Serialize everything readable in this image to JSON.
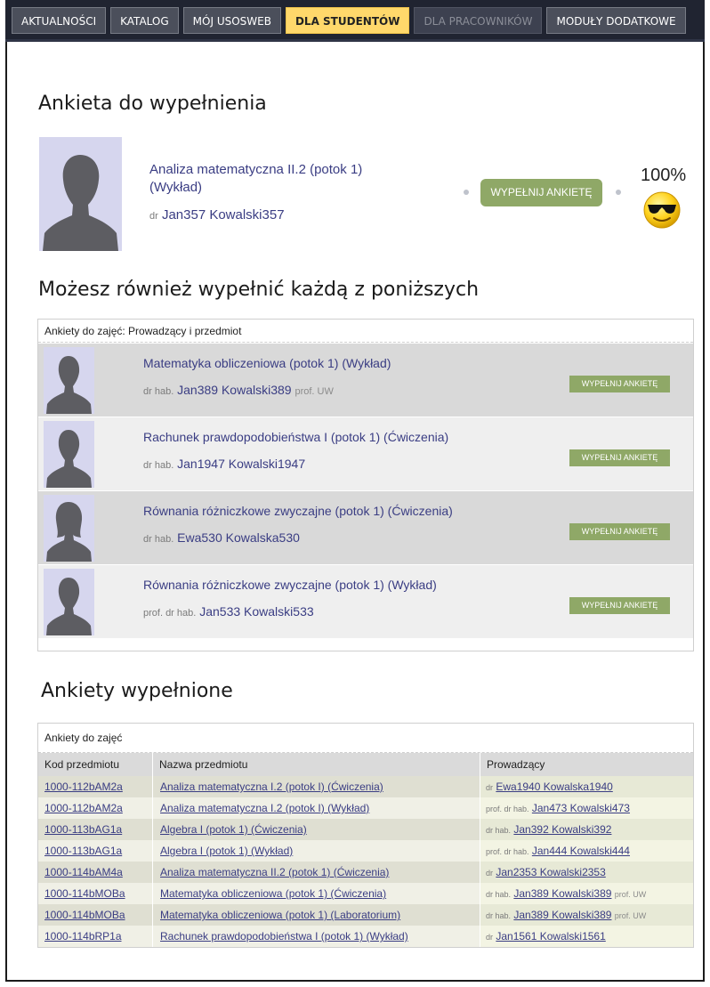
{
  "nav": {
    "tabs": [
      {
        "label": "AKTUALNOŚCI",
        "state": "normal"
      },
      {
        "label": "KATALOG",
        "state": "normal"
      },
      {
        "label": "MÓJ USOSWEB",
        "state": "normal"
      },
      {
        "label": "DLA STUDENTÓW",
        "state": "active"
      },
      {
        "label": "DLA PRACOWNIKÓW",
        "state": "disabled"
      },
      {
        "label": "MODUŁY DODATKOWE",
        "state": "normal"
      }
    ]
  },
  "main_survey": {
    "heading": "Ankieta do wypełnienia",
    "course": "Analiza matematyczna II.2 (potok 1)",
    "course_type": "(Wykład)",
    "teacher_prefix": "dr",
    "teacher_name": "Jan357 Kowalski357",
    "button": "WYPEŁNIJ ANKIETĘ",
    "progress": "100%",
    "progress_icon": "sunglasses-smiley-icon"
  },
  "options": {
    "heading": "Możesz również wypełnić każdą z poniższych",
    "box_title": "Ankiety do zajęć: Prowadzący i przedmiot",
    "rows": [
      {
        "course": "Matematyka obliczeniowa (potok 1) (Wykład)",
        "prefix": "dr hab.",
        "name": "Jan389 Kowalski389",
        "suffix": "prof. UW",
        "button": "WYPEŁNIJ ANKIETĘ"
      },
      {
        "course": "Rachunek prawdopodobieństwa I (potok 1) (Ćwiczenia)",
        "prefix": "dr hab.",
        "name": "Jan1947 Kowalski1947",
        "suffix": "",
        "button": "WYPEŁNIJ ANKIETĘ"
      },
      {
        "course": "Równania różniczkowe zwyczajne (potok 1) (Ćwiczenia)",
        "prefix": "dr hab.",
        "name": "Ewa530 Kowalska530",
        "suffix": "",
        "button": "WYPEŁNIJ ANKIETĘ"
      },
      {
        "course": "Równania różniczkowe zwyczajne (potok 1) (Wykład)",
        "prefix": "prof. dr hab.",
        "name": "Jan533 Kowalski533",
        "suffix": "",
        "button": "WYPEŁNIJ ANKIETĘ"
      }
    ]
  },
  "completed": {
    "heading": "Ankiety wypełnione",
    "caption": "Ankiety do zajęć",
    "columns": [
      "Kod przedmiotu",
      "Nazwa przedmiotu",
      "Prowadzący"
    ],
    "rows": [
      {
        "code": "1000-112bAM2a",
        "course": "Analiza matematyczna I.2 (potok I) (Ćwiczenia)",
        "prefix": "dr",
        "name": "Ewa1940 Kowalska1940",
        "suffix": ""
      },
      {
        "code": "1000-112bAM2a",
        "course": "Analiza matematyczna I.2 (potok I) (Wykład)",
        "prefix": "prof. dr hab.",
        "name": "Jan473 Kowalski473",
        "suffix": ""
      },
      {
        "code": "1000-113bAG1a",
        "course": "Algebra I (potok 1) (Ćwiczenia)",
        "prefix": "dr hab.",
        "name": "Jan392 Kowalski392",
        "suffix": ""
      },
      {
        "code": "1000-113bAG1a",
        "course": "Algebra I (potok 1) (Wykład)",
        "prefix": "prof. dr hab.",
        "name": "Jan444 Kowalski444",
        "suffix": ""
      },
      {
        "code": "1000-114bAM4a",
        "course": "Analiza matematyczna II.2 (potok 1) (Ćwiczenia)",
        "prefix": "dr",
        "name": "Jan2353 Kowalski2353",
        "suffix": ""
      },
      {
        "code": "1000-114bMOBa",
        "course": "Matematyka obliczeniowa (potok 1) (Ćwiczenia)",
        "prefix": "dr hab.",
        "name": "Jan389 Kowalski389",
        "suffix": "prof. UW"
      },
      {
        "code": "1000-114bMOBa",
        "course": "Matematyka obliczeniowa (potok 1) (Laboratorium)",
        "prefix": "dr hab.",
        "name": "Jan389 Kowalski389",
        "suffix": "prof. UW"
      },
      {
        "code": "1000-114bRP1a",
        "course": "Rachunek prawdopodobieństwa I (potok 1) (Wykład)",
        "prefix": "dr",
        "name": "Jan1561 Kowalski1561",
        "suffix": ""
      }
    ]
  }
}
